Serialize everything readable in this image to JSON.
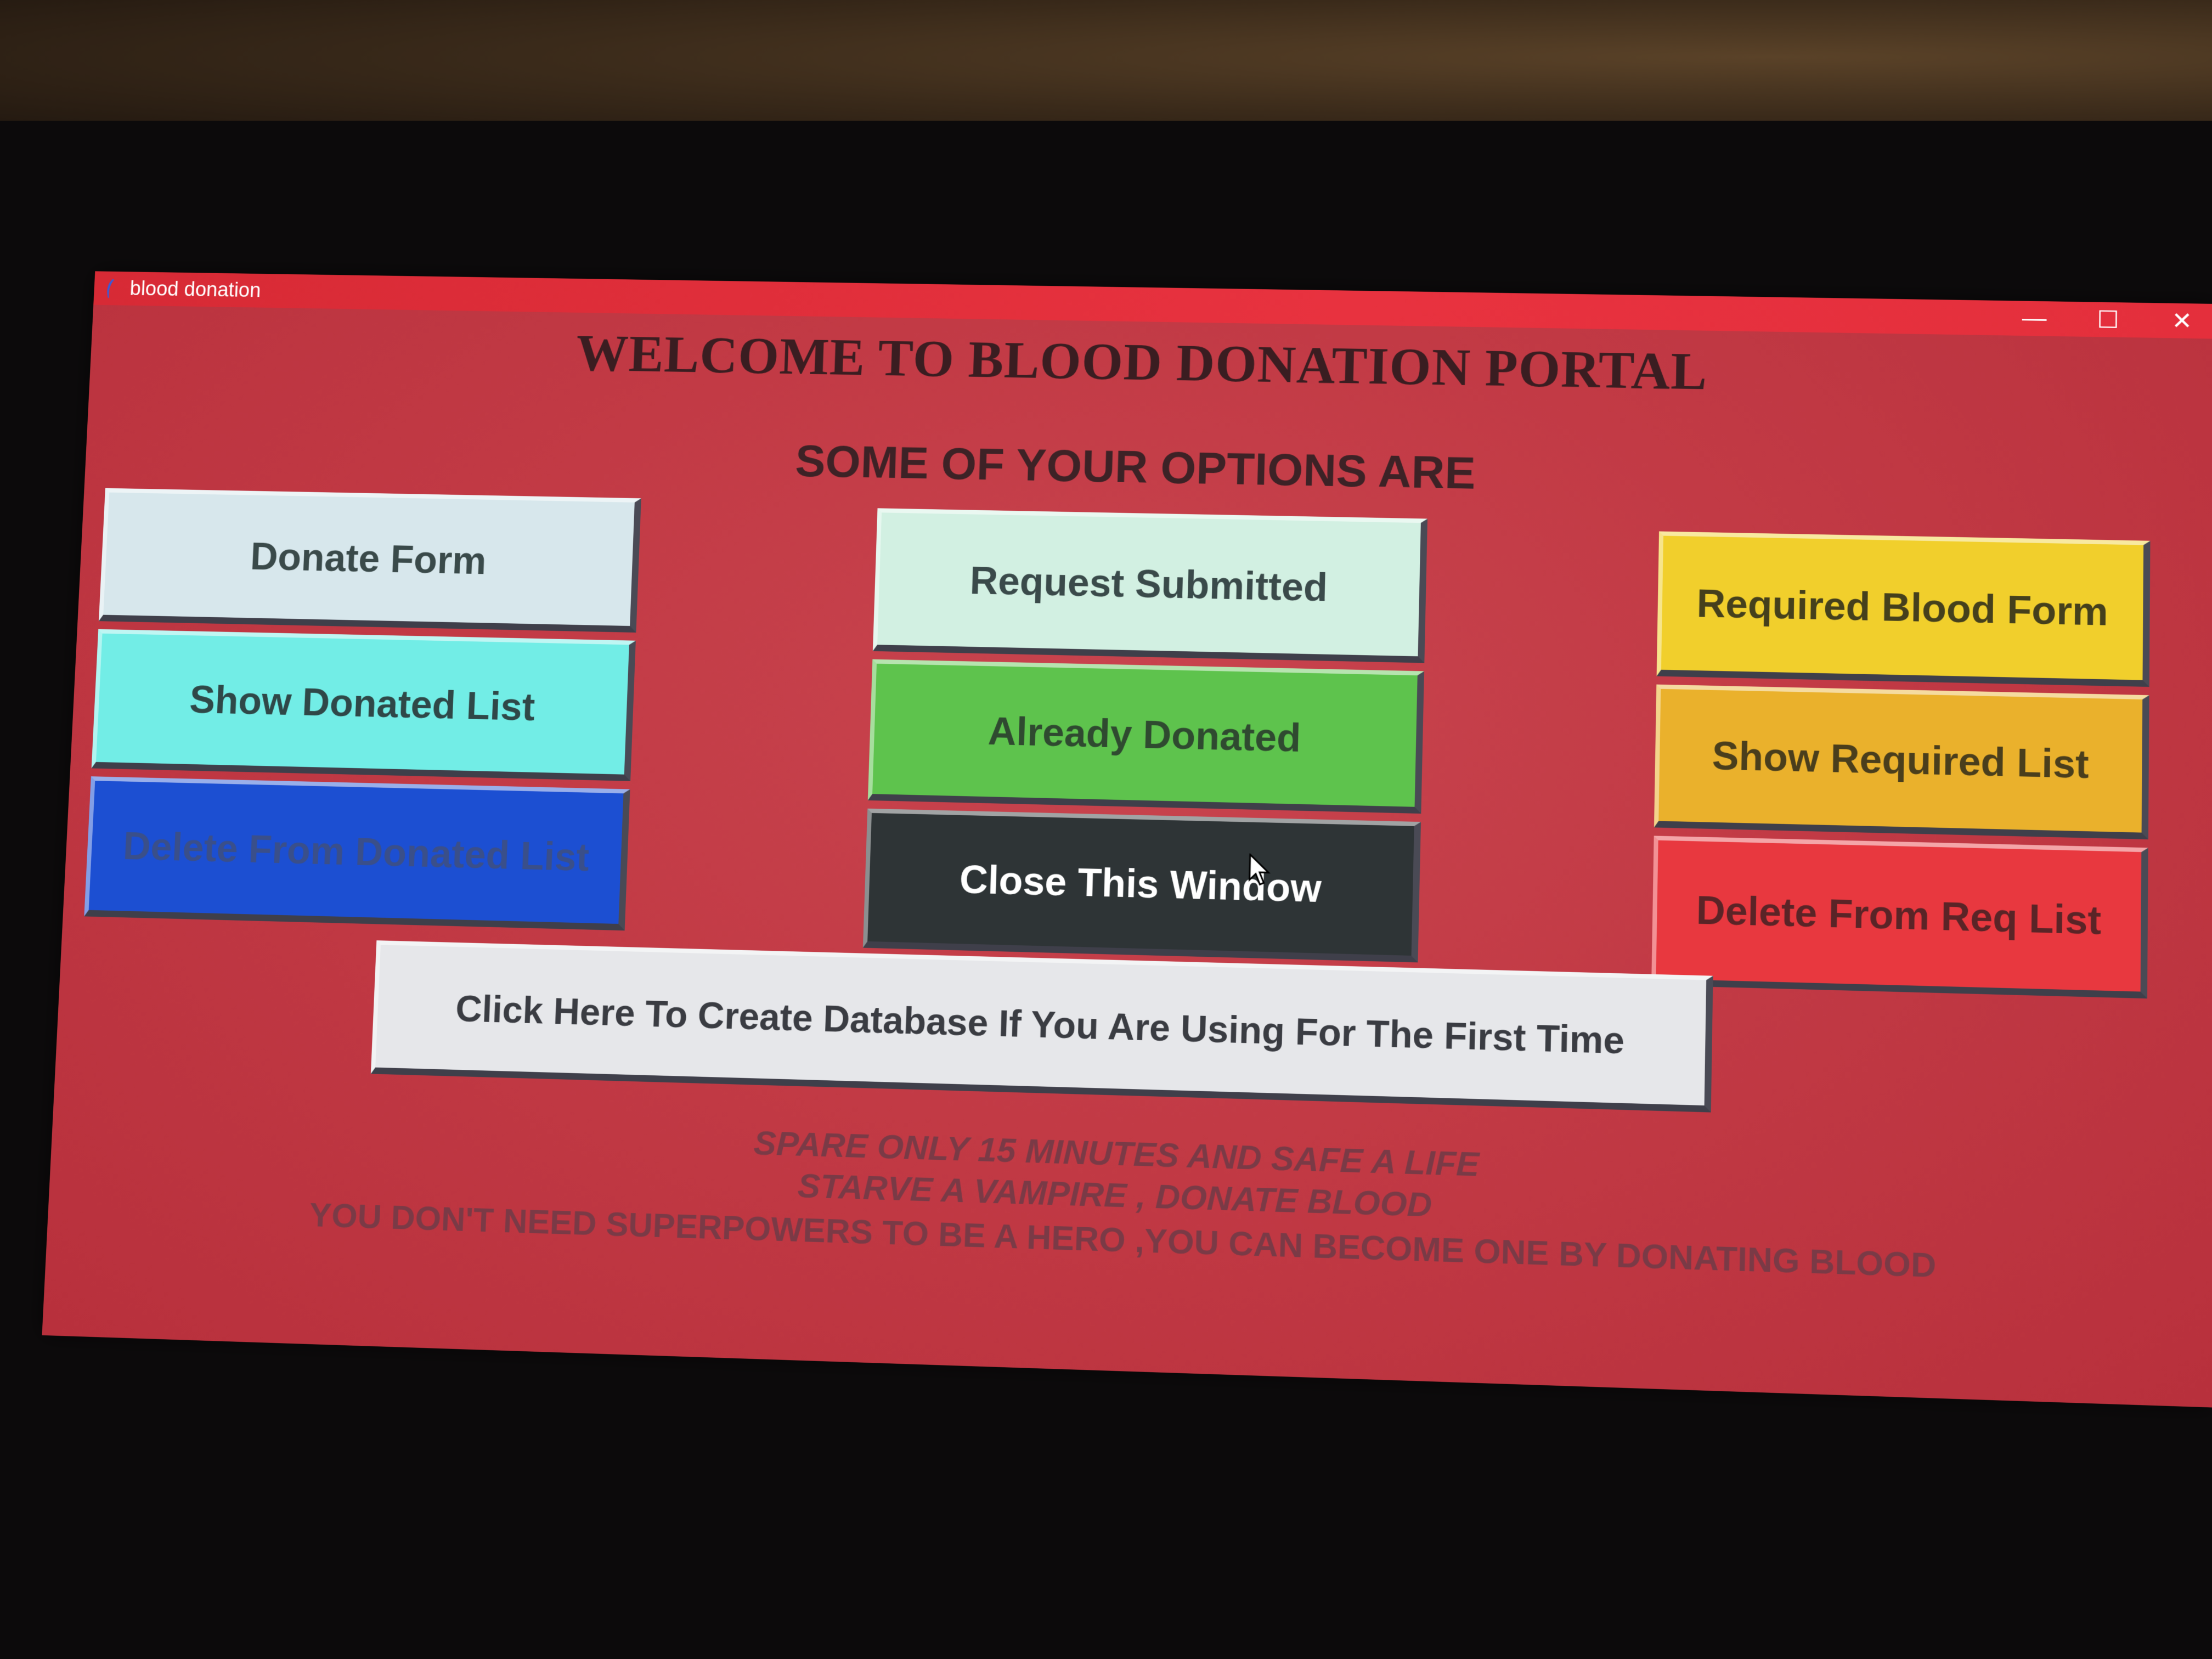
{
  "window": {
    "title": "blood donation",
    "icon": "feather-icon",
    "controls": {
      "minimize": "—",
      "maximize": "☐",
      "close": "✕"
    }
  },
  "main": {
    "heading": "WELCOME TO BLOOD DONATION PORTAL",
    "subheading": "SOME OF YOUR OPTIONS ARE"
  },
  "buttons": {
    "donate_form": "Donate Form",
    "show_donated_list": "Show Donated List",
    "delete_from_donated_list": "Delete From Donated List",
    "request_submitted": "Request Submitted",
    "already_donated": "Already Donated",
    "close_this_window": "Close This Window",
    "required_blood_form": "Required Blood Form",
    "show_required_list": "Show Required List",
    "delete_from_req_list": "Delete From Req List",
    "create_database": "Click Here To Create Database If You Are Using For The First Time"
  },
  "footer": {
    "line1": "SPARE ONLY 15 MINUTES AND SAFE A LIFE",
    "line2": "STARVE A VAMPIRE , DONATE BLOOD",
    "line3": "YOU DON'T NEED SUPERPOWERS TO BE A HERO ,YOU CAN BECOME ONE BY DONATING BLOOD"
  },
  "colors": {
    "window_bg": "#c23a45",
    "titlebar": "#e8323f",
    "donate_form": "#d7e7ec",
    "show_donated_list": "#72ede6",
    "delete_from_donated_list": "#1c4fd2",
    "request_submitted": "#d2f0e2",
    "already_donated": "#5ec34d",
    "close_this_window": "#2e3436",
    "required_blood_form": "#f1cf2c",
    "show_required_list": "#eab12c",
    "delete_from_req_list": "#e8383f",
    "create_database": "#e6e7ea"
  }
}
